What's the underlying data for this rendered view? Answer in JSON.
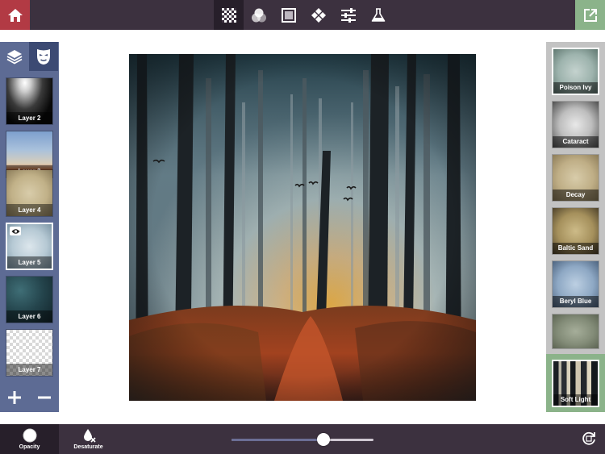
{
  "toolbar": {
    "home_icon": "home-icon",
    "tools": [
      {
        "icon": "texture-grid-icon",
        "active": true
      },
      {
        "icon": "blend-circles-icon",
        "active": false
      },
      {
        "icon": "frame-square-icon",
        "active": false
      },
      {
        "icon": "diamond-grid-icon",
        "active": false
      },
      {
        "icon": "sliders-icon",
        "active": false
      },
      {
        "icon": "flask-icon",
        "active": false
      }
    ],
    "export_icon": "share-export-icon"
  },
  "layers_panel": {
    "tabs": [
      {
        "icon": "layers-icon",
        "active": false
      },
      {
        "icon": "mask-icon",
        "active": true
      }
    ],
    "layers": [
      {
        "label": "Layer 2",
        "selected": false
      },
      {
        "label": "Layer 3",
        "selected": false
      },
      {
        "label": "Layer 4",
        "selected": false
      },
      {
        "label": "Layer 5",
        "selected": true
      },
      {
        "label": "Layer 6",
        "selected": false
      },
      {
        "label": "Layer 7",
        "selected": false
      }
    ],
    "add_icon": "plus-icon",
    "remove_icon": "minus-icon"
  },
  "presets_panel": {
    "presets": [
      {
        "label": "Poison Ivy"
      },
      {
        "label": "Cataract"
      },
      {
        "label": "Decay"
      },
      {
        "label": "Baltic Sand"
      },
      {
        "label": "Beryl Blue"
      },
      {
        "label": ""
      }
    ],
    "active_blend": {
      "label": "Soft Light"
    }
  },
  "bottom": {
    "opacity_label": "Opacity",
    "desaturate_label": "Desaturate",
    "slider_value": 0.65,
    "reset_icon": "reset-rotate-icon"
  },
  "colors": {
    "bar_bg": "#3c313f",
    "home_red": "#b23a44",
    "export_green": "#8bb38a",
    "left_panel": "#5d6b94",
    "right_panel": "#c3c3c3"
  }
}
